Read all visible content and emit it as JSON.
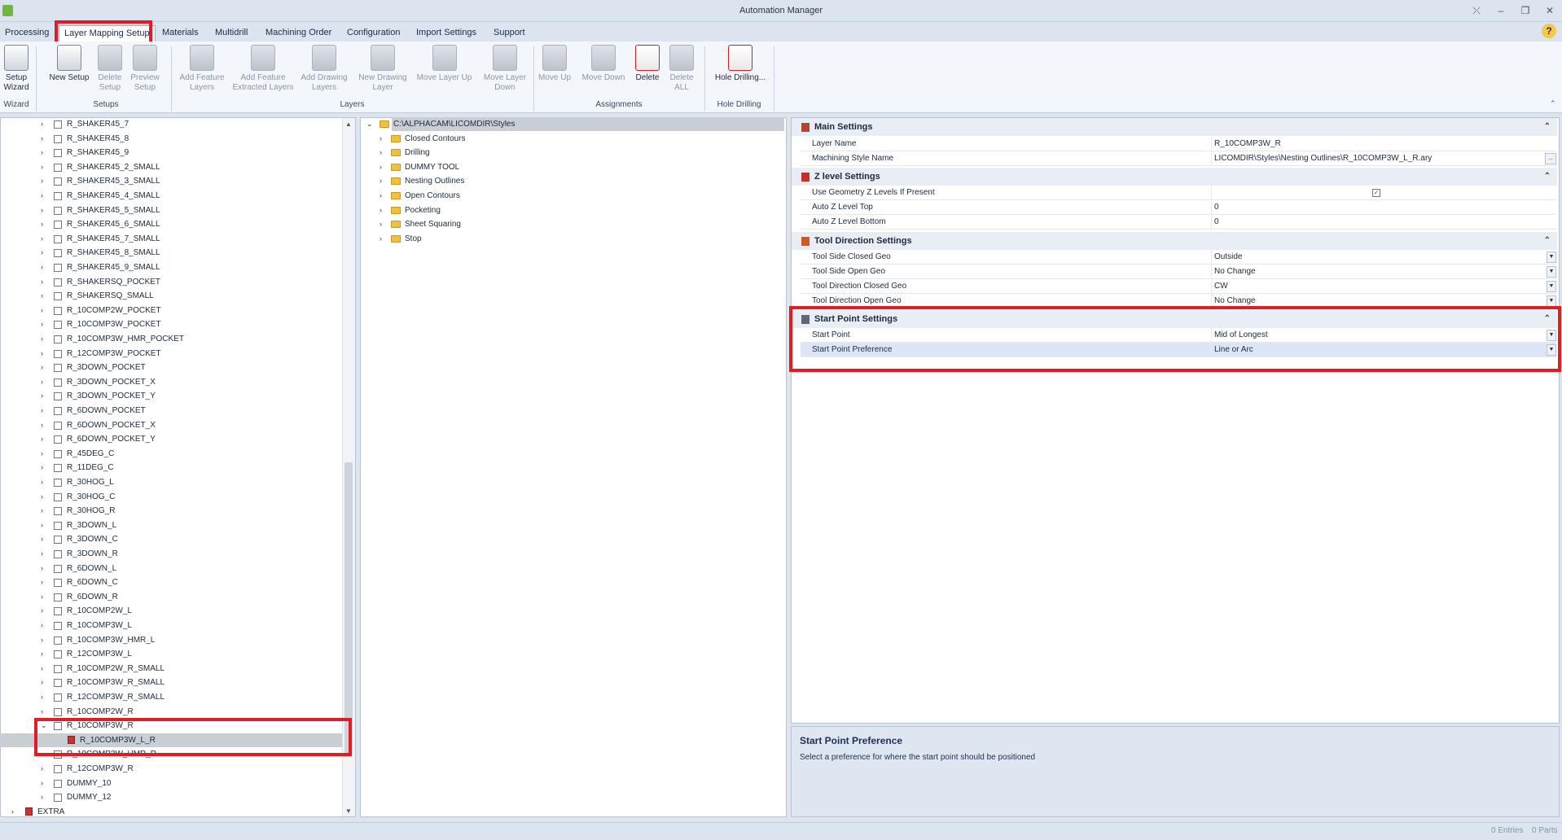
{
  "window": {
    "title": "Automation Manager",
    "controls": [
      "⤫",
      "–",
      "❐",
      "✕"
    ]
  },
  "menu": {
    "tabs": [
      "Processing",
      "Layer Mapping Setup",
      "Materials",
      "Multidrill",
      "Machining Order",
      "Configuration",
      "Import Settings",
      "Support"
    ],
    "active": "Layer Mapping Setup",
    "help": "?"
  },
  "ribbon": {
    "buttons": [
      {
        "label": "Setup\nWizard",
        "icon": "setup-wizard-icon",
        "enabled": true
      },
      {
        "label": "New Setup",
        "icon": "new-setup-icon",
        "enabled": true
      },
      {
        "label": "Delete\nSetup",
        "icon": "delete-setup-icon",
        "enabled": false
      },
      {
        "label": "Preview\nSetup",
        "icon": "preview-setup-icon",
        "enabled": false
      },
      {
        "label": "Add Feature\nLayers",
        "icon": "add-feature-layers-icon",
        "enabled": false
      },
      {
        "label": "Add Feature\nExtracted Layers",
        "icon": "add-extracted-layers-icon",
        "enabled": false
      },
      {
        "label": "Add Drawing\nLayers",
        "icon": "add-drawing-layers-icon",
        "enabled": false
      },
      {
        "label": "New Drawing\nLayer",
        "icon": "new-drawing-layer-icon",
        "enabled": false
      },
      {
        "label": "Move Layer Up",
        "icon": "move-layer-up-icon",
        "enabled": false
      },
      {
        "label": "Move Layer\nDown",
        "icon": "move-layer-down-icon",
        "enabled": false
      },
      {
        "label": "Move Up",
        "icon": "move-up-icon",
        "enabled": false
      },
      {
        "label": "Move Down",
        "icon": "move-down-icon",
        "enabled": false
      },
      {
        "label": "Delete",
        "icon": "delete-icon",
        "enabled": true
      },
      {
        "label": "Delete\nALL",
        "icon": "delete-all-icon",
        "enabled": false
      },
      {
        "label": "Hole Drilling...",
        "icon": "hole-drilling-icon",
        "enabled": true
      }
    ],
    "groups": [
      "Wizard",
      "Setups",
      "Layers",
      "Assignments",
      "Hole Drilling"
    ]
  },
  "layers_tree": {
    "items": [
      "R_SHAKER45_7",
      "R_SHAKER45_8",
      "R_SHAKER45_9",
      "R_SHAKER45_2_SMALL",
      "R_SHAKER45_3_SMALL",
      "R_SHAKER45_4_SMALL",
      "R_SHAKER45_5_SMALL",
      "R_SHAKER45_6_SMALL",
      "R_SHAKER45_7_SMALL",
      "R_SHAKER45_8_SMALL",
      "R_SHAKER45_9_SMALL",
      "R_SHAKERSQ_POCKET",
      "R_SHAKERSQ_SMALL",
      "R_10COMP2W_POCKET",
      "R_10COMP3W_POCKET",
      "R_10COMP3W_HMR_POCKET",
      "R_12COMP3W_POCKET",
      "R_3DOWN_POCKET",
      "R_3DOWN_POCKET_X",
      "R_3DOWN_POCKET_Y",
      "R_6DOWN_POCKET",
      "R_6DOWN_POCKET_X",
      "R_6DOWN_POCKET_Y",
      "R_45DEG_C",
      "R_11DEG_C",
      "R_30HOG_L",
      "R_30HOG_C",
      "R_30HOG_R",
      "R_3DOWN_L",
      "R_3DOWN_C",
      "R_3DOWN_R",
      "R_6DOWN_L",
      "R_6DOWN_C",
      "R_6DOWN_R",
      "R_10COMP2W_L",
      "R_10COMP3W_L",
      "R_10COMP3W_HMR_L",
      "R_12COMP3W_L",
      "R_10COMP2W_R_SMALL",
      "R_10COMP3W_R_SMALL",
      "R_12COMP3W_R_SMALL",
      "R_10COMP2W_R",
      "R_10COMP3W_R"
    ],
    "child": "R_10COMP3W_L_R",
    "after": [
      "R_10COMP3W_HMR_R",
      "R_12COMP3W_R",
      "DUMMY_10",
      "DUMMY_12"
    ],
    "root_extra": "EXTRA"
  },
  "styles_tree": {
    "root": "C:\\ALPHACAM\\LICOMDIR\\Styles",
    "folders": [
      "Closed Contours",
      "Drilling",
      "DUMMY TOOL",
      "Nesting Outlines",
      "Open Contours",
      "Pocketing",
      "Sheet Squaring",
      "Stop"
    ]
  },
  "properties": {
    "sections": [
      {
        "title": "Main Settings",
        "icon": "main-settings-icon",
        "rows": [
          {
            "label": "Layer Name",
            "value": "R_10COMP3W_R"
          },
          {
            "label": "Machining Style Name",
            "value": "LICOMDIR\\Styles\\Nesting Outlines\\R_10COMP3W_L_R.ary",
            "button": "..."
          }
        ]
      },
      {
        "title": "Z level Settings",
        "icon": "z-level-icon",
        "rows": [
          {
            "label": "Use Geometry Z Levels If Present",
            "value": "",
            "checked": true
          },
          {
            "label": "Auto Z Level Top",
            "value": "0"
          },
          {
            "label": "Auto Z Level Bottom",
            "value": "0"
          }
        ]
      },
      {
        "title": "Tool Direction Settings",
        "icon": "tool-direction-icon",
        "rows": [
          {
            "label": "Tool Side Closed Geo",
            "value": "Outside"
          },
          {
            "label": "Tool Side Open Geo",
            "value": "No Change"
          },
          {
            "label": "Tool Direction Closed Geo",
            "value": "CW"
          },
          {
            "label": "Tool Direction Open Geo",
            "value": "No Change"
          }
        ]
      },
      {
        "title": "Start Point Settings",
        "icon": "start-point-icon",
        "rows": [
          {
            "label": "Start Point",
            "value": "Mid of Longest"
          },
          {
            "label": "Start Point Preference",
            "value": "Line or Arc"
          }
        ]
      }
    ]
  },
  "description": {
    "title": "Start Point Preference",
    "text": "Select a preference for where the start point should be positioned"
  },
  "status": {
    "entries": "0 Entries",
    "parts": "0 Parts"
  }
}
